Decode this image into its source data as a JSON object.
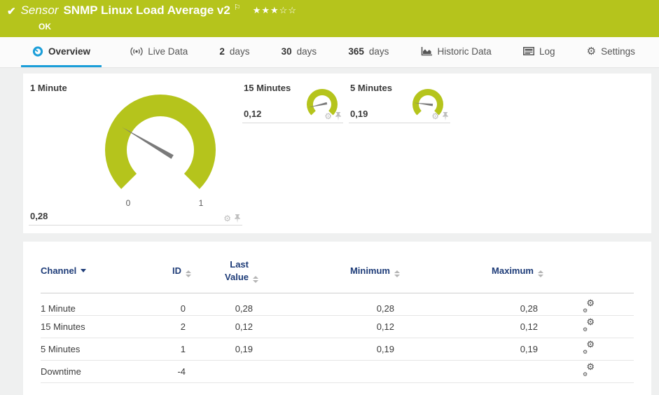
{
  "header": {
    "kind": "Sensor",
    "title": "SNMP Linux Load Average v2",
    "status": "OK",
    "priority_stars": "★★★☆☆",
    "background_color": "#b5c41c"
  },
  "tabs": {
    "overview": "Overview",
    "live_data": "Live Data",
    "d2_num": "2",
    "d2_label": "days",
    "d30_num": "30",
    "d30_label": "days",
    "d365_num": "365",
    "d365_label": "days",
    "historic": "Historic Data",
    "log": "Log",
    "settings": "Settings",
    "active_underline_color": "#1b9ed9"
  },
  "chart_data": [
    {
      "type": "gauge",
      "title": "1 Minute",
      "value": 0.28,
      "value_label": "0,28",
      "min": 0,
      "max": 1,
      "tick_labels": [
        "0",
        "1"
      ],
      "arc_color": "#b5c41c",
      "needle_color": "#7a7a7a"
    },
    {
      "type": "gauge",
      "title": "15 Minutes",
      "value": 0.12,
      "value_label": "0,12",
      "min": 0,
      "max": 1,
      "arc_color": "#b5c41c",
      "needle_color": "#7a7a7a"
    },
    {
      "type": "gauge",
      "title": "5 Minutes",
      "value": 0.19,
      "value_label": "0,19",
      "min": 0,
      "max": 1,
      "arc_color": "#b5c41c",
      "needle_color": "#7a7a7a"
    }
  ],
  "table": {
    "header_text_color": "#1e3c78",
    "columns": {
      "channel": "Channel",
      "id": "ID",
      "last_value_line1": "Last",
      "last_value_line2": "Value",
      "minimum": "Minimum",
      "maximum": "Maximum"
    },
    "rows": [
      {
        "channel": "1 Minute",
        "id": "0",
        "last_value": "0,28",
        "minimum": "0,28",
        "maximum": "0,28"
      },
      {
        "channel": "15 Minutes",
        "id": "2",
        "last_value": "0,12",
        "minimum": "0,12",
        "maximum": "0,12"
      },
      {
        "channel": "5 Minutes",
        "id": "1",
        "last_value": "0,19",
        "minimum": "0,19",
        "maximum": "0,19"
      },
      {
        "channel": "Downtime",
        "id": "-4",
        "last_value": "",
        "minimum": "",
        "maximum": ""
      }
    ]
  }
}
